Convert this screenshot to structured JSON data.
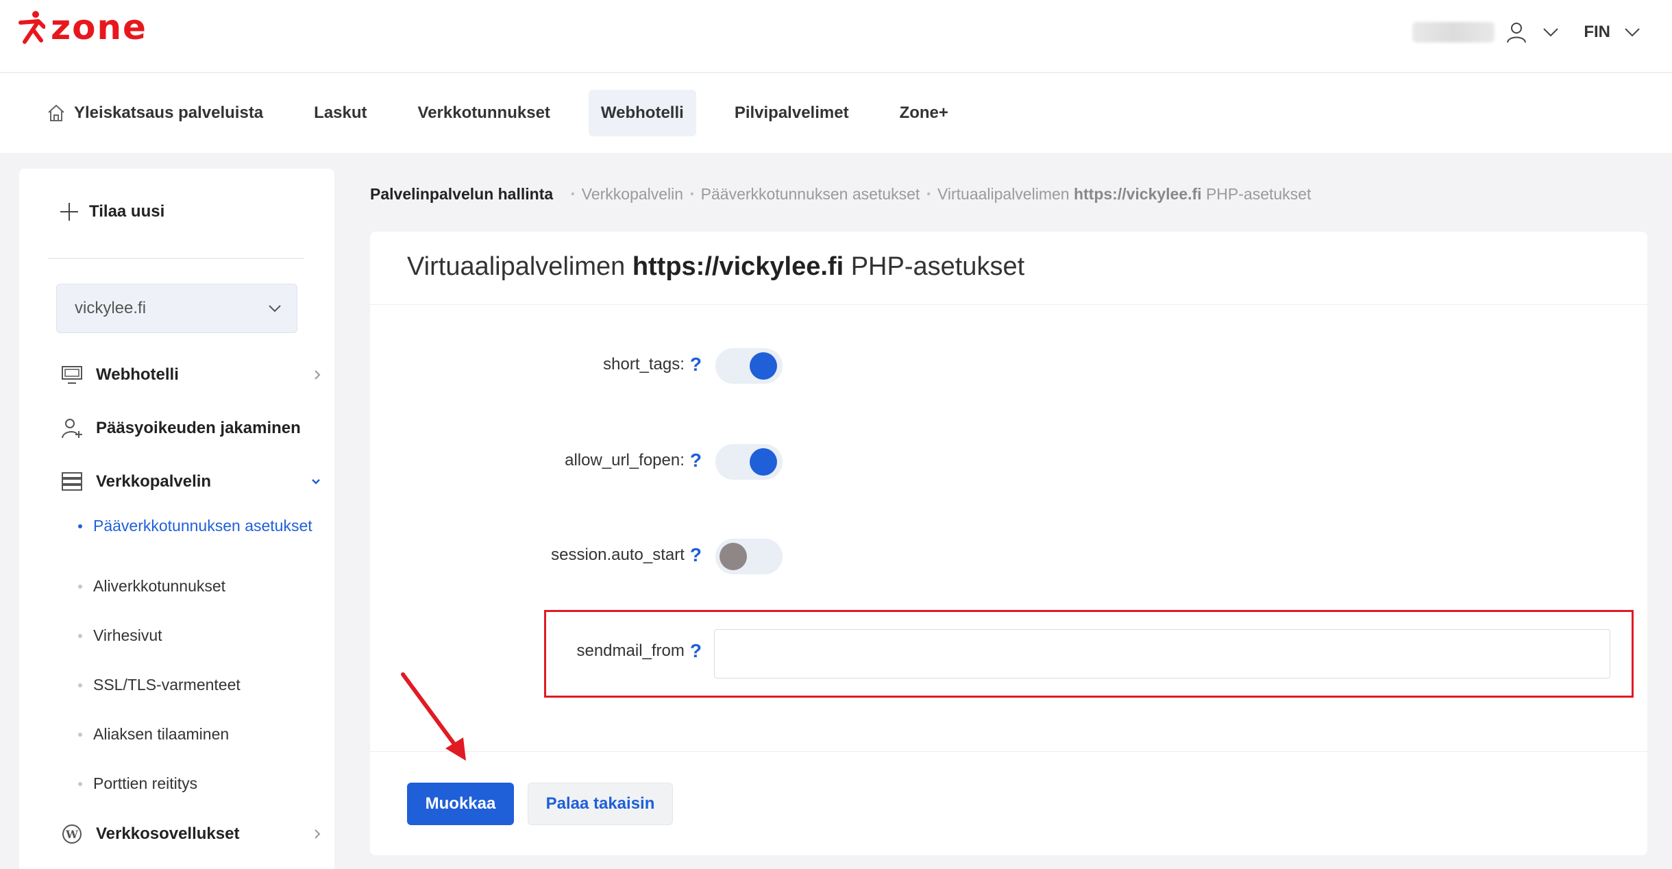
{
  "header": {
    "logo_text": "zone",
    "language": "FIN"
  },
  "nav": {
    "items": [
      {
        "label": "Yleiskatsaus palveluista",
        "active": false
      },
      {
        "label": "Laskut",
        "active": false
      },
      {
        "label": "Verkkotunnukset",
        "active": false
      },
      {
        "label": "Webhotelli",
        "active": true
      },
      {
        "label": "Pilvipalvelimet",
        "active": false
      },
      {
        "label": "Zone+",
        "active": false
      }
    ]
  },
  "sidebar": {
    "order_new": "Tilaa uusi",
    "domain_select": "vickylee.fi",
    "items": {
      "webhotelli": "Webhotelli",
      "access": "Pääsyoikeuden jakaminen",
      "webserver": "Verkkopalvelin",
      "webapps": "Verkkosovellukset"
    },
    "subitems": [
      {
        "label": "Pääverkkotunnuksen asetukset",
        "active": true
      },
      {
        "label": "Aliverkkotunnukset",
        "active": false
      },
      {
        "label": "Virhesivut",
        "active": false
      },
      {
        "label": "SSL/TLS-varmenteet",
        "active": false
      },
      {
        "label": "Aliaksen tilaaminen",
        "active": false
      },
      {
        "label": "Porttien reititys",
        "active": false
      }
    ]
  },
  "breadcrumb": {
    "root": "Palvelinpalvelun hallinta",
    "c1": "Verkkopalvelin",
    "c2": "Pääverkkotunnuksen asetukset",
    "c3_prefix": "Virtuaalipalvelimen ",
    "c3_bold": "https://vickylee.fi",
    "c3_suffix": " PHP-asetukset"
  },
  "page": {
    "title_prefix": "Virtuaalipalvelimen ",
    "title_bold": "https://vickylee.fi",
    "title_suffix": " PHP-asetukset"
  },
  "settings": {
    "short_tags": {
      "label": "short_tags:",
      "on": true
    },
    "allow_url_fopen": {
      "label": "allow_url_fopen:",
      "on": true
    },
    "session_auto_start": {
      "label": "session.auto_start",
      "on": false
    },
    "sendmail_from": {
      "label": "sendmail_from",
      "value": ""
    },
    "help_glyph": "?"
  },
  "actions": {
    "edit": "Muokkaa",
    "back": "Palaa takaisin"
  },
  "colors": {
    "brand_red": "#e8171d",
    "accent_blue": "#1f5fd8",
    "annotation_red": "#e01b24"
  }
}
